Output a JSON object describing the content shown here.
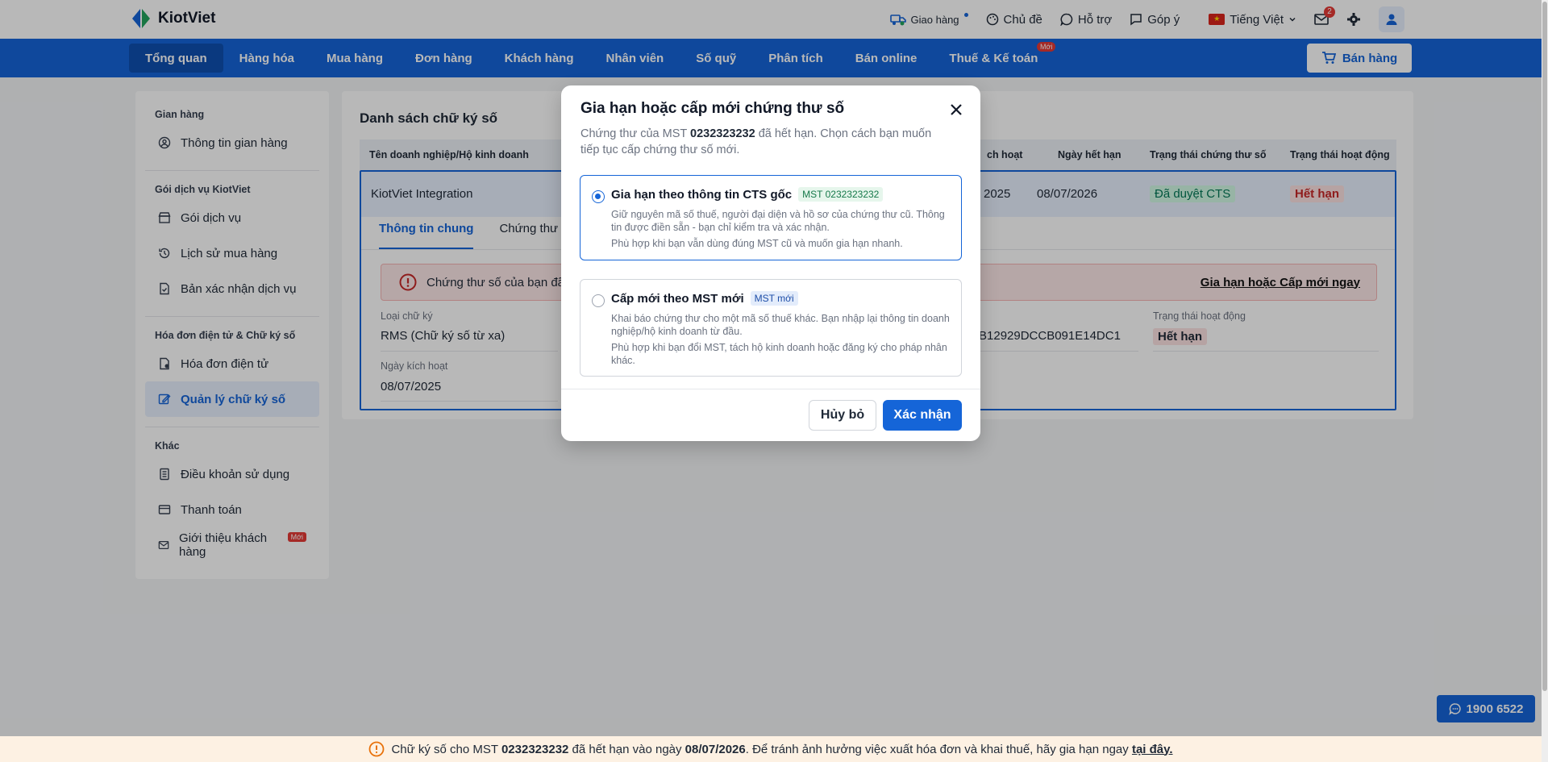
{
  "header": {
    "logo_text": "KiotViet",
    "delivery_label": "Giao hàng",
    "theme_label": "Chủ đề",
    "support_label": "Hỗ trợ",
    "feedback_label": "Góp ý",
    "language_label": "Tiếng Việt",
    "mail_count": "2"
  },
  "nav": {
    "items": [
      "Tổng quan",
      "Hàng hóa",
      "Mua hàng",
      "Đơn hàng",
      "Khách hàng",
      "Nhân viên",
      "Số quỹ",
      "Phân tích",
      "Bán online",
      "Thuế & Kế toán"
    ],
    "new_badge": "Mới",
    "sell_button": "Bán hàng"
  },
  "sidebar": {
    "section1_heading": "Gian hàng",
    "store_info": "Thông tin gian hàng",
    "section2_heading": "Gói dịch vụ KiotViet",
    "service_pack": "Gói dịch vụ",
    "purchase_history": "Lịch sử mua hàng",
    "service_confirm": "Bản xác nhận dịch vụ",
    "section3_heading": "Hóa đơn điện tử & Chữ ký số",
    "einvoice": "Hóa đơn điện tử",
    "signature_mgmt": "Quản lý chữ ký số",
    "section4_heading": "Khác",
    "terms": "Điều khoản sử dụng",
    "payment": "Thanh toán",
    "referral": "Giới thiệu khách hàng",
    "new_badge": "Mới"
  },
  "main": {
    "title": "Danh sách chữ ký số",
    "columns": {
      "business": "Tên doanh nghiệp/Hộ kinh doanh",
      "activation_partial": "ch hoạt",
      "expiry": "Ngày hết hạn",
      "cert_status": "Trạng thái chứng thư số",
      "active_status": "Trạng thái hoạt động"
    },
    "row": {
      "business": "KiotViet Integration",
      "activation_partial": "2025",
      "expiry": "08/07/2026",
      "cert_status": "Đã duyệt CTS",
      "active_status": "Hết hạn"
    },
    "tabs": [
      "Thông tin chung",
      "Chứng thư s"
    ],
    "alert_text": "Chứng thư số của bạn đã",
    "alert_link": "Gia hạn hoặc Cấp mới ngay",
    "fields": {
      "sig_type_label": "Loại chữ ký",
      "sig_type_value": "RMS (Chữ ký số từ xa)",
      "activation_label": "Ngày kích hoạt",
      "activation_value": "08/07/2025",
      "serial_partial": "B12929DCCB091E14DC1",
      "active_status_label": "Trạng thái hoạt động",
      "active_status_value": "Hết hạn"
    }
  },
  "modal": {
    "title": "Gia hạn hoặc cấp mới chứng thư số",
    "subtitle_prefix": "Chứng thư của MST ",
    "subtitle_mst": "0232323232",
    "subtitle_suffix": " đã hết hạn. Chọn cách bạn muốn tiếp tục cấp chứng thư số mới.",
    "option1": {
      "title": "Gia hạn theo thông tin CTS gốc",
      "chip": "MST 0232323232",
      "desc": "Giữ nguyên mã số thuế, người đại diện và hồ sơ của chứng thư cũ. Thông tin được điền sẵn - bạn chỉ kiểm tra và xác nhận.",
      "note": "Phù hợp khi bạn vẫn dùng đúng MST cũ và muốn gia hạn nhanh."
    },
    "option2": {
      "title": "Cấp mới theo MST mới",
      "chip": "MST mới",
      "desc": "Khai báo chứng thư cho một mã số thuế khác. Bạn nhập lại thông tin doanh nghiệp/hộ kinh doanh từ đầu.",
      "note": "Phù hợp khi bạn đổi MST, tách hộ kinh doanh hoặc đăng ký cho pháp nhân khác."
    },
    "cancel": "Hủy bỏ",
    "confirm": "Xác nhận"
  },
  "banner": {
    "prefix": "Chữ ký số cho MST ",
    "mst": "0232323232",
    "middle": " đã hết hạn vào ngày ",
    "date": "08/07/2026",
    "suffix": ". Để tránh ảnh hưởng việc xuất hóa đơn và khai thuế, hãy gia hạn ngay ",
    "link": "tại đây."
  },
  "hotline": "1900 6522",
  "colors": {
    "primary": "#1565d8",
    "danger": "#e53935",
    "success_bg": "#d1fae5"
  }
}
